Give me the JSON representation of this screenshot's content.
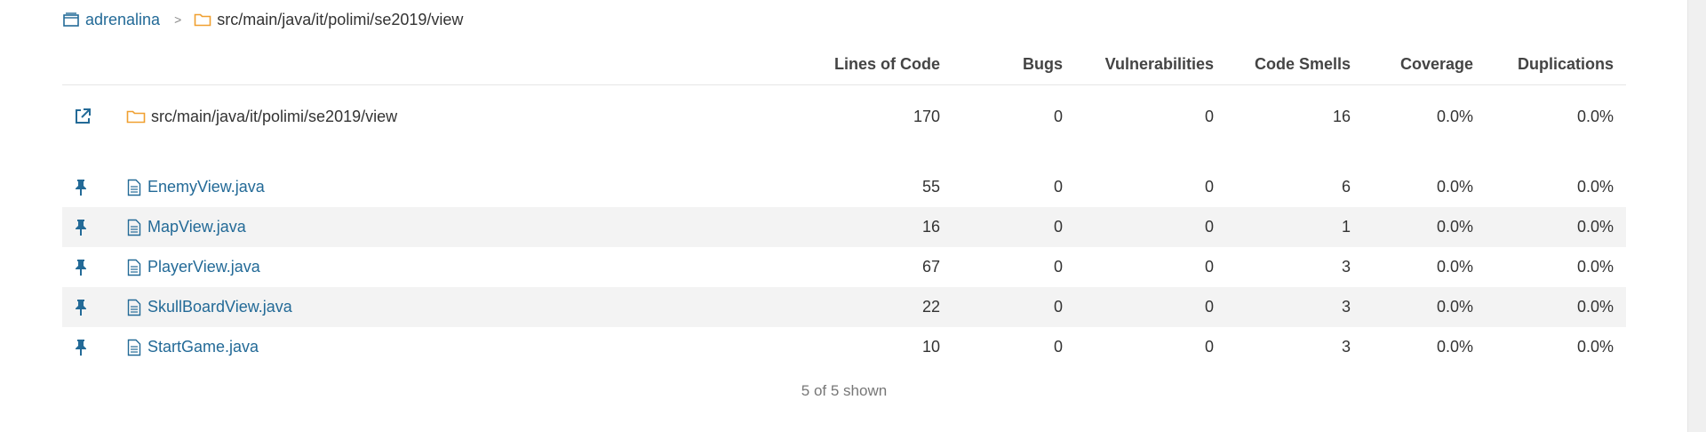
{
  "breadcrumb": {
    "project": {
      "label": "adrenalina",
      "icon": "project-icon"
    },
    "separator": ">",
    "directory": {
      "label": "src/main/java/it/polimi/se2019/view",
      "icon": "folder-icon"
    }
  },
  "table": {
    "columns": [
      "Lines of Code",
      "Bugs",
      "Vulnerabilities",
      "Code Smells",
      "Coverage",
      "Duplications"
    ],
    "base_row": {
      "icon": "open-external-icon",
      "name": "src/main/java/it/polimi/se2019/view",
      "name_icon": "folder-icon",
      "values": [
        "170",
        "0",
        "0",
        "16",
        "0.0%",
        "0.0%"
      ]
    },
    "files": [
      {
        "icon": "pin-icon",
        "name": "EnemyView.java",
        "name_icon": "file-icon",
        "values": [
          "55",
          "0",
          "0",
          "6",
          "0.0%",
          "0.0%"
        ]
      },
      {
        "icon": "pin-icon",
        "name": "MapView.java",
        "name_icon": "file-icon",
        "values": [
          "16",
          "0",
          "0",
          "1",
          "0.0%",
          "0.0%"
        ]
      },
      {
        "icon": "pin-icon",
        "name": "PlayerView.java",
        "name_icon": "file-icon",
        "values": [
          "67",
          "0",
          "0",
          "3",
          "0.0%",
          "0.0%"
        ]
      },
      {
        "icon": "pin-icon",
        "name": "SkullBoardView.java",
        "name_icon": "file-icon",
        "values": [
          "22",
          "0",
          "0",
          "3",
          "0.0%",
          "0.0%"
        ]
      },
      {
        "icon": "pin-icon",
        "name": "StartGame.java",
        "name_icon": "file-icon",
        "values": [
          "10",
          "0",
          "0",
          "3",
          "0.0%",
          "0.0%"
        ]
      }
    ]
  },
  "footer": {
    "shown_text": "5 of 5 shown"
  },
  "colors": {
    "link": "#236a97",
    "folder": "#f0a030",
    "row_alt": "#f3f3f3",
    "icon": "#236a97"
  }
}
